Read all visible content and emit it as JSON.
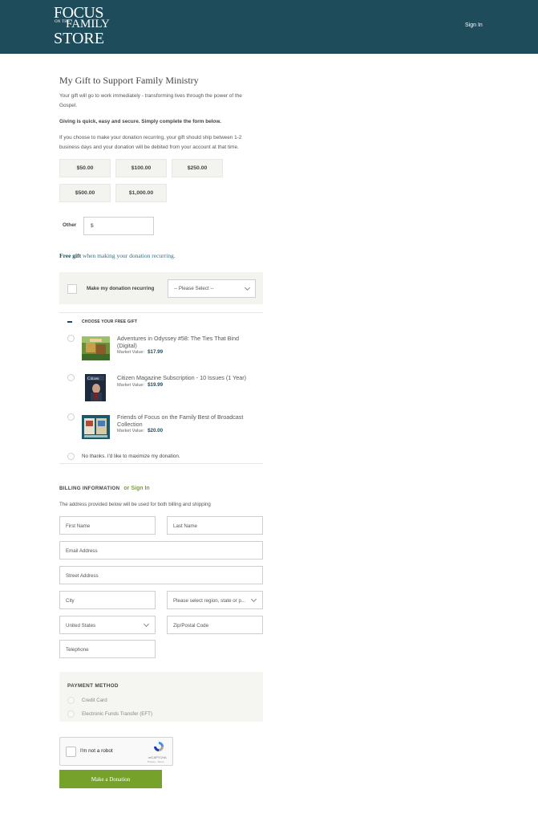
{
  "header": {
    "logo": {
      "line1": "FOCUS",
      "line2": "ON THE",
      "line3": "FAMILY",
      "line4": "STORE"
    },
    "sign_in": "Sign In"
  },
  "intro": {
    "title": "My Gift to Support Family Ministry",
    "p1": "Your gift will go to work immediately - transforming lives through the power of the Gospel.",
    "p2": "Giving is quick, easy and secure. Simply complete the form below.",
    "p3": "If you choose to make your donation recurring, your gift should ship between 1-2 business days and your donation will be debited from your account at that time."
  },
  "amounts": [
    "$50.00",
    "$100.00",
    "$250.00",
    "$500.00",
    "$1,000.00"
  ],
  "other": {
    "label": "Other",
    "currency": "$"
  },
  "free_gift": {
    "bold": "Free gift",
    "rest": "when making your donation recurring."
  },
  "recurring": {
    "label": "Make my donation recurring",
    "select_value": "-- Please Select --"
  },
  "gifts": {
    "heading": "CHOOSE YOUR FREE GIFT",
    "market_value_label": "Market Value:",
    "items": [
      {
        "title": "Adventures in Odyssey #58: The Ties That Bind (Digital)",
        "price": "$17.99",
        "thumb_icon": "odyssey-cover-icon"
      },
      {
        "title": "Citizen Magazine Subscription - 10 Issues (1 Year)",
        "price": "$19.99",
        "thumb_icon": "citizen-magazine-icon"
      },
      {
        "title": "Friends of Focus on the Family Best of Broadcast Collection",
        "price": "$20.00",
        "thumb_icon": "broadcast-collection-icon"
      }
    ],
    "no_thanks": "No thanks. I'd like to maximize my donation."
  },
  "billing": {
    "heading": "BILLING INFORMATION",
    "or_sign_in": "or Sign In",
    "note": "The address provided below will be used for both billing and shipping",
    "first_name": "First Name",
    "last_name": "Last Name",
    "email": "Email Address",
    "street": "Street Address",
    "city": "City",
    "region": "Please select region, state or p...",
    "country": "United States",
    "zip": "Zip/Postal Code",
    "telephone": "Telephone"
  },
  "payment": {
    "heading": "PAYMENT METHOD",
    "options": [
      "Credit Card",
      "Electronic Funds Transfer (EFT)"
    ]
  },
  "captcha": {
    "label": "I'm not a robot",
    "brand": "reCAPTCHA",
    "terms": "Privacy - Terms"
  },
  "submit": "Make a Donation",
  "colors": {
    "header_bg": "#1e4c5a",
    "accent_green": "#76a22b",
    "link_teal": "#1e4c5a"
  }
}
